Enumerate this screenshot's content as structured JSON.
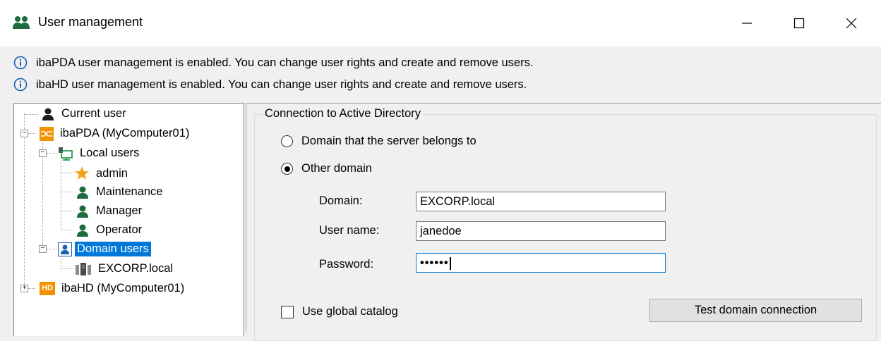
{
  "window": {
    "title": "User management",
    "icon": "users-icon"
  },
  "info_messages": [
    "ibaPDA user management is enabled. You can change user rights and create and remove users.",
    "ibaHD user management is enabled. You can change user rights and create and remove users."
  ],
  "tree": {
    "current_user": "Current user",
    "ibapda": "ibaPDA (MyComputer01)",
    "local_users": "Local users",
    "admin": "admin",
    "maintenance": "Maintenance",
    "manager": "Manager",
    "operator": "Operator",
    "domain_users": "Domain users",
    "excorp": "EXCORP.local",
    "ibahd": "ibaHD (MyComputer01)",
    "ibahd_badge": "HD",
    "selected": "Domain users"
  },
  "ad": {
    "group_title": "Connection to Active Directory",
    "radio_server_domain": "Domain that the server belongs to",
    "radio_other_domain": "Other domain",
    "selected_radio": "Other domain",
    "domain_label": "Domain:",
    "domain_value": "EXCORP.local",
    "username_label": "User name:",
    "username_value": "janedoe",
    "password_label": "Password:",
    "password_value": "••••••",
    "global_catalog_label": "Use global catalog",
    "global_catalog_checked": false,
    "test_button": "Test domain connection"
  },
  "colors": {
    "accent": "#0078d7",
    "user_green": "#1e6b3c",
    "star": "#f4a21a",
    "iba_orange": "#f39200"
  }
}
